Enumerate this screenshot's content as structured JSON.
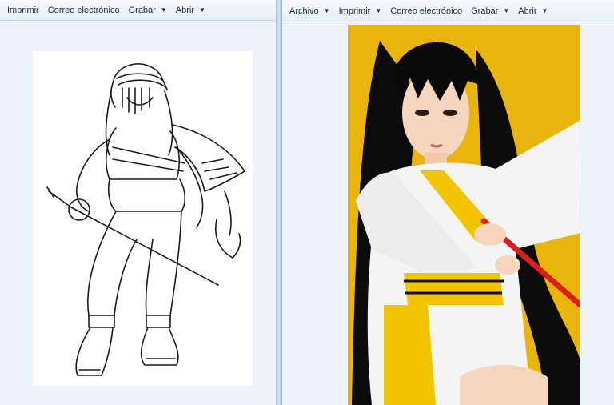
{
  "left_window": {
    "toolbar": [
      {
        "label": "Imprimir"
      },
      {
        "label": "Correo electrónico"
      },
      {
        "label": "Grabar"
      },
      {
        "label": "Abrir"
      }
    ]
  },
  "right_window": {
    "toolbar": [
      {
        "label": "Archivo"
      },
      {
        "label": "Imprimir"
      },
      {
        "label": "Correo electrónico"
      },
      {
        "label": "Grabar"
      },
      {
        "label": "Abrir"
      }
    ]
  },
  "colors": {
    "photo_background": "#e9b50c",
    "robe": "#f4f4f4",
    "sash": "#f2c500",
    "sword": "#d81e1e"
  }
}
